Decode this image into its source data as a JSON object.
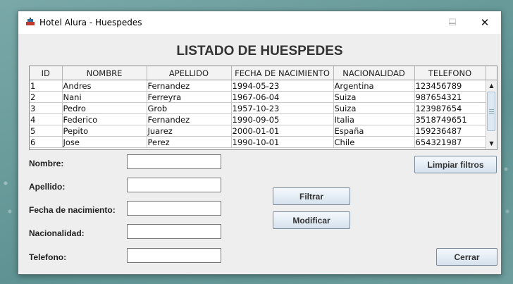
{
  "window": {
    "title": "Hotel Alura - Huespedes",
    "minimize_glyph": "—",
    "maximize_glyph": "☐",
    "close_glyph": "✕"
  },
  "heading": "LISTADO DE HUESPEDES",
  "table": {
    "columns": [
      "ID",
      "NOMBRE",
      "APELLIDO",
      "FECHA DE NACIMIENTO",
      "NACIONALIDAD",
      "TELEFONO"
    ],
    "rows": [
      [
        "1",
        "Andres",
        "Fernandez",
        "1994-05-23",
        "Argentina",
        "123456789"
      ],
      [
        "2",
        "Nani",
        "Ferreyra",
        "1967-06-04",
        "Suiza",
        "987654321"
      ],
      [
        "3",
        "Pedro",
        "Grob",
        "1957-10-23",
        "Suiza",
        "123987654"
      ],
      [
        "4",
        "Federico",
        "Fernandez",
        "1990-09-05",
        "Italia",
        "3518749651"
      ],
      [
        "5",
        "Pepito",
        "Juarez",
        "2000-01-01",
        "España",
        "159236487"
      ],
      [
        "6",
        "Jose",
        "Perez",
        "1990-10-01",
        "Chile",
        "654321987"
      ]
    ]
  },
  "form": {
    "nombre_label": "Nombre:",
    "apellido_label": "Apellido:",
    "fecha_label": "Fecha de nacimiento:",
    "nacionalidad_label": "Nacionalidad:",
    "telefono_label": "Telefono:",
    "nombre_value": "",
    "apellido_value": "",
    "fecha_value": "",
    "nacionalidad_value": "",
    "telefono_value": ""
  },
  "buttons": {
    "limpiar": "Limpiar filtros",
    "filtrar": "Filtrar",
    "modificar": "Modificar",
    "cerrar": "Cerrar"
  },
  "icons": {
    "app": "hotel-app-icon",
    "scroll_up": "▲",
    "scroll_down": "▼"
  }
}
